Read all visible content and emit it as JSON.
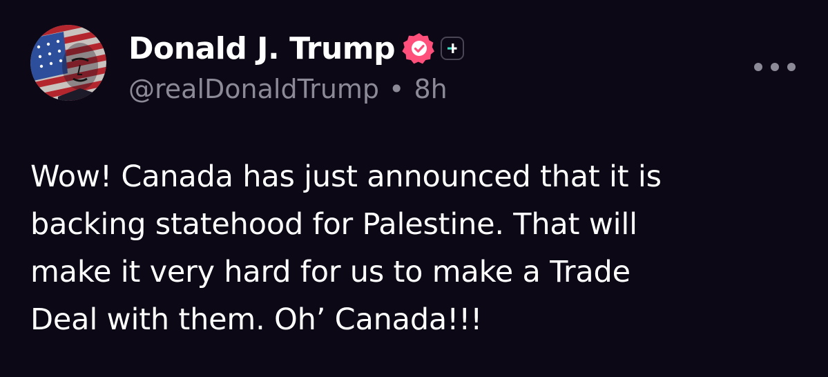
{
  "author": {
    "display_name": "Donald J. Trump",
    "handle": "@realDonaldTrump",
    "separator": "•",
    "timestamp": "8h",
    "verified_color": "#ff4f7b",
    "avatar_icon": "avatar-flag-portrait"
  },
  "post": {
    "lines": [
      "Wow! Canada has just announced that it is",
      "backing statehood for Palestine. That will",
      "make it very hard for us to make a Trade",
      "Deal with them. Oh’ Canada!!!"
    ]
  },
  "icons": {
    "verified": "verified-badge-icon",
    "plus": "plus-badge-icon",
    "more": "more-options-icon"
  },
  "colors": {
    "background": "#0c0815",
    "text": "#ffffff",
    "muted": "#8d8a97",
    "accent_green": "#3fe0c5"
  }
}
